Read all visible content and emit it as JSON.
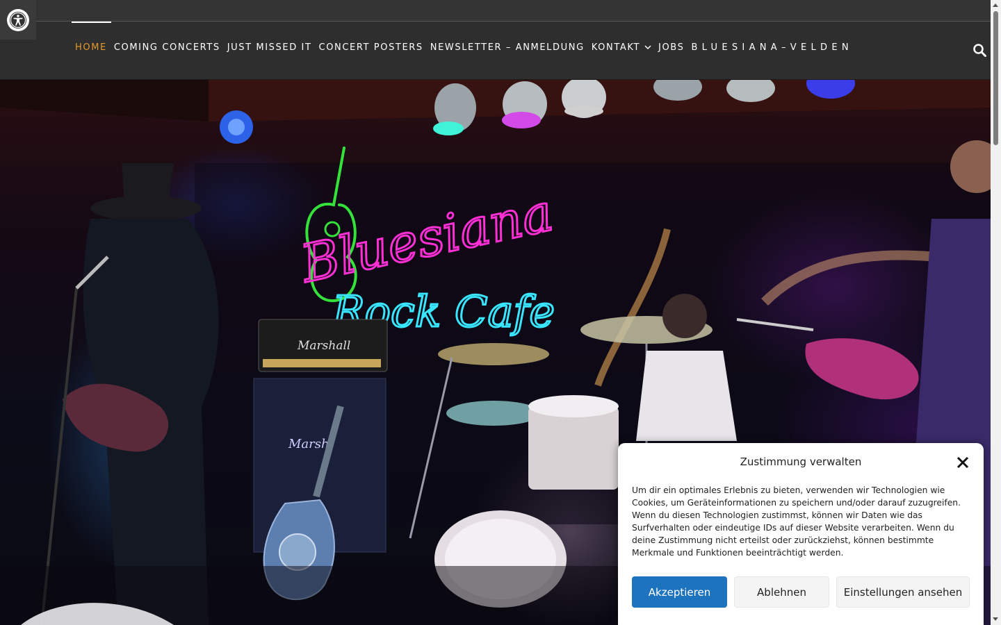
{
  "accessibility": {
    "icon": "accessibility-icon"
  },
  "nav": {
    "items": [
      {
        "label": "HOME",
        "active": true
      },
      {
        "label": "COMING CONCERTS"
      },
      {
        "label": "JUST MISSED IT"
      },
      {
        "label": "CONCERT POSTERS"
      },
      {
        "label": "NEWSLETTER – ANMELDUNG"
      },
      {
        "label": "KONTAKT",
        "has_dropdown": true
      },
      {
        "label": "JOBS"
      },
      {
        "label": "BLUESIANA–VELDEN"
      }
    ],
    "active_color": "#e39a2b",
    "search_icon": "search-icon"
  },
  "hero": {
    "neon_line1": "Bluesiana",
    "neon_line2": "Rock Cafe",
    "amp_brand": "Marshall",
    "amp_brand2": "Marsh"
  },
  "consent": {
    "title": "Zustimmung verwalten",
    "text": "Um dir ein optimales Erlebnis zu bieten, verwenden wir Technologien wie Cookies, um Geräteinformationen zu speichern und/oder darauf zuzugreifen. Wenn du diesen Technologien zustimmst, können wir Daten wie das Surfverhalten oder eindeutige IDs auf dieser Website verarbeiten. Wenn du deine Zustimmung nicht erteilst oder zurückziehst, können bestimmte Merkmale und Funktionen beeinträchtigt werden.",
    "accept_label": "Akzeptieren",
    "deny_label": "Ablehnen",
    "prefs_label": "Einstellungen ansehen",
    "accent": "#1e73be"
  }
}
